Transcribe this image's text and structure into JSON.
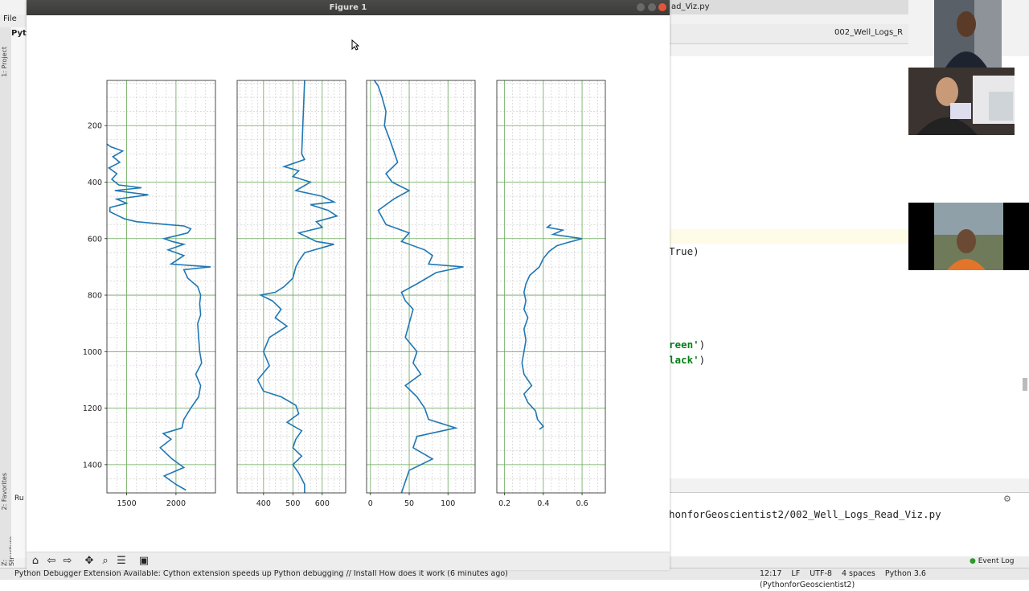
{
  "ide": {
    "menu_file": "File",
    "project_header": "Pyt",
    "title_fragment": "ad_Viz.py",
    "editor_tab": "002_Well_Logs_R",
    "code_lines": [
      {
        "pre": "True",
        "post": ")",
        "y": 307
      },
      {
        "pre": "reen'",
        "post": ")",
        "y": 423
      },
      {
        "pre": "lack'",
        "post": ")",
        "y": 442
      }
    ],
    "run_path": "honforGeoscientist2/002_Well_Logs_Read_Viz.py",
    "event_log": "Event Log",
    "side_labels": [
      "1: Project",
      "2: Favorites",
      "Z: Structure"
    ],
    "run_label": "Ru"
  },
  "status": {
    "message": "Python Debugger Extension Available: Cython extension speeds up Python debugging // Install  How does it work (6 minutes ago)",
    "position": "12:17",
    "line_sep": "LF",
    "encoding": "UTF-8",
    "indent": "4 spaces",
    "interpreter": "Python 3.6 (PythonforGeoscientist2)"
  },
  "figure": {
    "window_title": "Figure 1",
    "toolbar": [
      "home-icon",
      "back-icon",
      "forward-icon",
      "pan-icon",
      "zoom-icon",
      "configure-icon",
      "save-icon"
    ],
    "accent": "#1f77b4",
    "grid_major": "#6aaa5a",
    "grid_minor": "#c8c8c8"
  },
  "chart_data": [
    {
      "type": "line",
      "ylim": [
        1500,
        40
      ],
      "yticks": [
        200,
        400,
        600,
        800,
        1000,
        1200,
        1400
      ],
      "xlim": [
        1300,
        2400
      ],
      "xticks": [
        1500,
        2000
      ],
      "orientation": "vertical-depth",
      "series": [
        {
          "values": [
            [
              265,
              1300
            ],
            [
              275,
              1340
            ],
            [
              290,
              1460
            ],
            [
              310,
              1360
            ],
            [
              330,
              1430
            ],
            [
              350,
              1320
            ],
            [
              370,
              1400
            ],
            [
              390,
              1350
            ],
            [
              410,
              1420
            ],
            [
              420,
              1650
            ],
            [
              430,
              1380
            ],
            [
              445,
              1720
            ],
            [
              460,
              1400
            ],
            [
              475,
              1500
            ],
            [
              490,
              1330
            ],
            [
              505,
              1330
            ],
            [
              520,
              1420
            ],
            [
              530,
              1480
            ],
            [
              540,
              1600
            ],
            [
              550,
              1900
            ],
            [
              555,
              2080
            ],
            [
              565,
              2150
            ],
            [
              580,
              2120
            ],
            [
              600,
              1880
            ],
            [
              610,
              1960
            ],
            [
              620,
              2080
            ],
            [
              640,
              1920
            ],
            [
              660,
              2080
            ],
            [
              690,
              1950
            ],
            [
              700,
              2350
            ],
            [
              710,
              2080
            ],
            [
              740,
              2120
            ],
            [
              770,
              2220
            ],
            [
              800,
              2250
            ],
            [
              830,
              2240
            ],
            [
              870,
              2250
            ],
            [
              900,
              2220
            ],
            [
              950,
              2230
            ],
            [
              1000,
              2240
            ],
            [
              1040,
              2260
            ],
            [
              1080,
              2200
            ],
            [
              1120,
              2250
            ],
            [
              1160,
              2230
            ],
            [
              1200,
              2150
            ],
            [
              1240,
              2080
            ],
            [
              1270,
              2060
            ],
            [
              1290,
              1870
            ],
            [
              1310,
              1950
            ],
            [
              1340,
              1840
            ],
            [
              1380,
              1960
            ],
            [
              1410,
              2080
            ],
            [
              1440,
              1880
            ],
            [
              1470,
              2000
            ],
            [
              1490,
              2100
            ]
          ]
        }
      ]
    },
    {
      "type": "line",
      "ylim": [
        1500,
        40
      ],
      "yticks": [
        200,
        400,
        600,
        800,
        1000,
        1200,
        1400
      ],
      "xlim": [
        310,
        680
      ],
      "xticks": [
        400,
        500,
        600
      ],
      "orientation": "vertical-depth",
      "series": [
        {
          "values": [
            [
              40,
              540
            ],
            [
              300,
              530
            ],
            [
              320,
              540
            ],
            [
              345,
              470
            ],
            [
              360,
              520
            ],
            [
              380,
              500
            ],
            [
              400,
              560
            ],
            [
              430,
              510
            ],
            [
              450,
              600
            ],
            [
              470,
              640
            ],
            [
              480,
              560
            ],
            [
              500,
              620
            ],
            [
              520,
              650
            ],
            [
              540,
              580
            ],
            [
              560,
              600
            ],
            [
              580,
              520
            ],
            [
              610,
              580
            ],
            [
              620,
              640
            ],
            [
              650,
              540
            ],
            [
              680,
              520
            ],
            [
              700,
              510
            ],
            [
              740,
              500
            ],
            [
              770,
              470
            ],
            [
              790,
              440
            ],
            [
              800,
              390
            ],
            [
              820,
              430
            ],
            [
              850,
              460
            ],
            [
              880,
              440
            ],
            [
              910,
              480
            ],
            [
              950,
              420
            ],
            [
              1000,
              400
            ],
            [
              1050,
              420
            ],
            [
              1100,
              380
            ],
            [
              1140,
              400
            ],
            [
              1160,
              460
            ],
            [
              1190,
              510
            ],
            [
              1220,
              520
            ],
            [
              1250,
              480
            ],
            [
              1280,
              530
            ],
            [
              1310,
              510
            ],
            [
              1340,
              500
            ],
            [
              1370,
              530
            ],
            [
              1400,
              500
            ],
            [
              1430,
              520
            ],
            [
              1470,
              540
            ],
            [
              1500,
              540
            ]
          ]
        }
      ]
    },
    {
      "type": "line",
      "ylim": [
        1500,
        40
      ],
      "yticks": [
        200,
        400,
        600,
        800,
        1000,
        1200,
        1400
      ],
      "xlim": [
        -5,
        135
      ],
      "xticks": [
        0,
        50,
        100
      ],
      "orientation": "vertical-depth",
      "series": [
        {
          "values": [
            [
              40,
              5
            ],
            [
              60,
              10
            ],
            [
              100,
              15
            ],
            [
              150,
              20
            ],
            [
              200,
              18
            ],
            [
              250,
              25
            ],
            [
              290,
              30
            ],
            [
              330,
              35
            ],
            [
              370,
              20
            ],
            [
              400,
              28
            ],
            [
              430,
              50
            ],
            [
              460,
              30
            ],
            [
              500,
              10
            ],
            [
              550,
              20
            ],
            [
              580,
              50
            ],
            [
              610,
              40
            ],
            [
              640,
              70
            ],
            [
              660,
              80
            ],
            [
              690,
              75
            ],
            [
              700,
              120
            ],
            [
              720,
              85
            ],
            [
              760,
              60
            ],
            [
              790,
              40
            ],
            [
              820,
              45
            ],
            [
              850,
              55
            ],
            [
              900,
              50
            ],
            [
              950,
              45
            ],
            [
              1000,
              60
            ],
            [
              1040,
              55
            ],
            [
              1080,
              65
            ],
            [
              1120,
              45
            ],
            [
              1160,
              60
            ],
            [
              1200,
              70
            ],
            [
              1240,
              75
            ],
            [
              1270,
              110
            ],
            [
              1300,
              60
            ],
            [
              1340,
              55
            ],
            [
              1380,
              80
            ],
            [
              1420,
              50
            ],
            [
              1460,
              45
            ],
            [
              1500,
              40
            ]
          ]
        }
      ]
    },
    {
      "type": "line",
      "ylim": [
        1500,
        40
      ],
      "yticks": [
        200,
        400,
        600,
        800,
        1000,
        1200,
        1400
      ],
      "xlim": [
        0.16,
        0.72
      ],
      "xticks": [
        0.2,
        0.4,
        0.6
      ],
      "orientation": "vertical-depth",
      "series": [
        {
          "values": [
            [
              550,
              0.44
            ],
            [
              560,
              0.42
            ],
            [
              570,
              0.5
            ],
            [
              585,
              0.45
            ],
            [
              600,
              0.6
            ],
            [
              615,
              0.52
            ],
            [
              625,
              0.47
            ],
            [
              645,
              0.43
            ],
            [
              670,
              0.4
            ],
            [
              700,
              0.38
            ],
            [
              730,
              0.33
            ],
            [
              760,
              0.31
            ],
            [
              790,
              0.3
            ],
            [
              820,
              0.31
            ],
            [
              850,
              0.3
            ],
            [
              880,
              0.32
            ],
            [
              920,
              0.3
            ],
            [
              960,
              0.31
            ],
            [
              1000,
              0.3
            ],
            [
              1040,
              0.29
            ],
            [
              1080,
              0.3
            ],
            [
              1120,
              0.34
            ],
            [
              1150,
              0.3
            ],
            [
              1180,
              0.32
            ],
            [
              1210,
              0.36
            ],
            [
              1240,
              0.37
            ],
            [
              1265,
              0.4
            ],
            [
              1275,
              0.38
            ]
          ]
        }
      ]
    }
  ]
}
